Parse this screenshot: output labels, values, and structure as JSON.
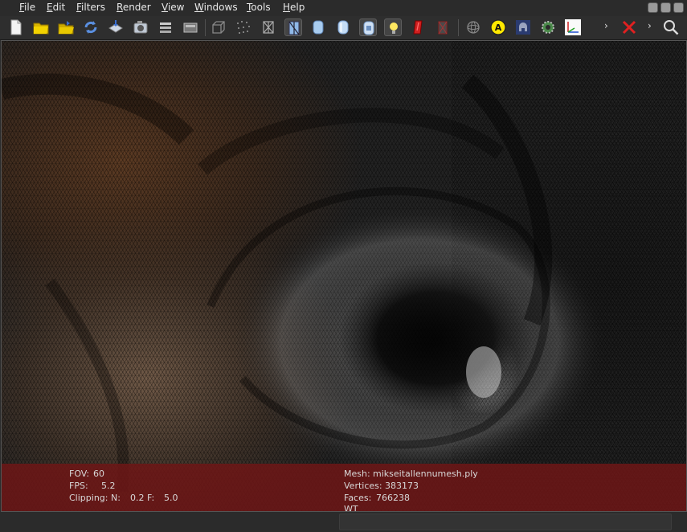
{
  "menu": {
    "items": [
      "File",
      "Edit",
      "Filters",
      "Render",
      "View",
      "Windows",
      "Tools",
      "Help"
    ]
  },
  "toolbar": {
    "icons": [
      "new-document-icon",
      "open-folder-icon",
      "open-project-icon",
      "reload-icon",
      "import-mesh-icon",
      "snapshot-icon",
      "layers-icon",
      "screenshot-icon",
      "bounding-box-icon",
      "points-icon",
      "wireframe-icon",
      "flat-lines-icon",
      "flat-icon",
      "smooth-icon",
      "texture-icon",
      "light-icon",
      "color-icon",
      "backface-icon",
      "trackball-icon",
      "annotation-icon",
      "dome-icon",
      "gear-icon",
      "axes-icon",
      "delete-icon",
      "search-icon"
    ]
  },
  "info": {
    "fov_label": "FOV:",
    "fov_value": "60",
    "fps_label": "FPS:",
    "fps_value": "5.2",
    "clip_label": "Clipping: N:",
    "clip_near": "0.2",
    "clip_far_label": "F:",
    "clip_far": "5.0",
    "mesh_label": "Mesh:",
    "mesh_value": "mikseitallennumesh.ply",
    "vertices_label": "Vertices:",
    "vertices_value": "383173",
    "faces_label": "Faces:",
    "faces_value": "766238",
    "extra": "WT"
  },
  "colors": {
    "info_panel": "#6e1616",
    "accent_red": "#cc2222",
    "toolbar_bg": "#2e2e2e"
  }
}
